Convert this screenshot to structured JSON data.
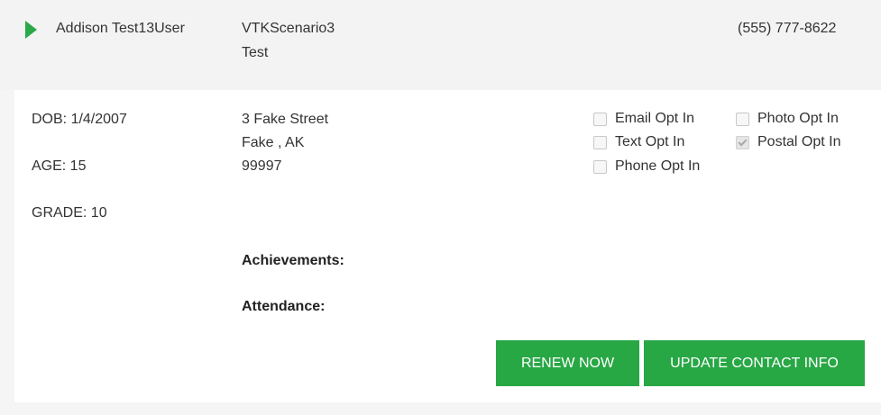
{
  "header": {
    "name": "Addison Test13User",
    "program_line1": "VTKScenario3",
    "program_line2": "Test",
    "phone": "(555) 777-8622"
  },
  "details": {
    "dob": "DOB: 1/4/2007",
    "age": "AGE: 15",
    "grade": "GRADE: 10",
    "address_line1": "3 Fake Street",
    "address_line2": "Fake , AK",
    "address_line3": "99997",
    "achievements_label": "Achievements:",
    "attendance_label": "Attendance:"
  },
  "opt_ins": [
    {
      "label": "Email Opt In",
      "checked": false
    },
    {
      "label": "Photo Opt In",
      "checked": false
    },
    {
      "label": "Text Opt In",
      "checked": false
    },
    {
      "label": "Postal Opt In",
      "checked": true
    },
    {
      "label": "Phone Opt In",
      "checked": false
    }
  ],
  "actions": {
    "renew_label": "RENEW NOW",
    "update_label": "UPDATE CONTACT INFO"
  },
  "colors": {
    "accent": "#28a745",
    "header_bg": "#f3f3f3",
    "card_bg": "#ffffff"
  }
}
